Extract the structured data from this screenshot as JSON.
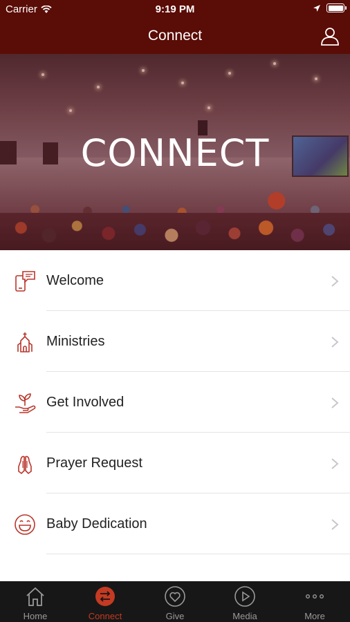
{
  "status_bar": {
    "carrier": "Carrier",
    "time": "9:19 PM"
  },
  "nav": {
    "title": "Connect",
    "profile_icon": "user-icon"
  },
  "hero": {
    "heading": "CONNECT",
    "overlay_color": "#781e28"
  },
  "menu": {
    "items": [
      {
        "label": "Welcome",
        "icon": "phone-chat-icon"
      },
      {
        "label": "Ministries",
        "icon": "church-icon"
      },
      {
        "label": "Get Involved",
        "icon": "hand-plant-icon"
      },
      {
        "label": "Prayer Request",
        "icon": "praying-hands-icon"
      },
      {
        "label": "Baby Dedication",
        "icon": "smile-face-icon"
      }
    ]
  },
  "tabbar": {
    "tabs": [
      {
        "label": "Home",
        "icon": "home-icon",
        "active": false
      },
      {
        "label": "Connect",
        "icon": "swap-arrows-icon",
        "active": true
      },
      {
        "label": "Give",
        "icon": "heart-icon",
        "active": false
      },
      {
        "label": "Media",
        "icon": "play-icon",
        "active": false
      },
      {
        "label": "More",
        "icon": "more-dots-icon",
        "active": false
      }
    ]
  },
  "colors": {
    "brand": "#5a0c06",
    "accent": "#c43a22",
    "icon_red": "#b8352a",
    "tabbar_bg": "#171717",
    "tab_inactive": "#9a9a9a"
  }
}
